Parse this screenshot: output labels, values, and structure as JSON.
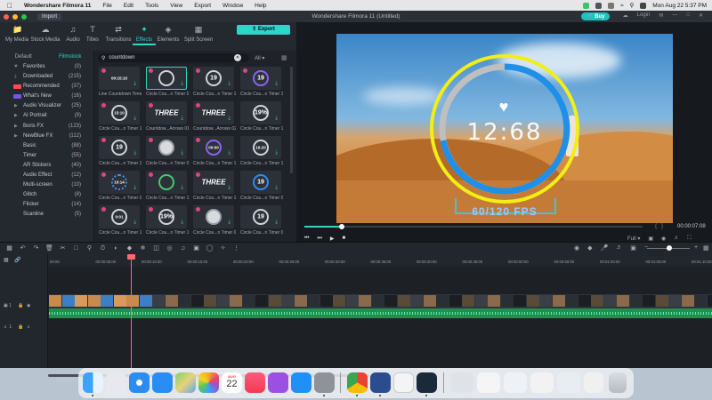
{
  "menubar": {
    "app_name": "Wondershare Filmora 11",
    "items": [
      "File",
      "Edit",
      "Tools",
      "View",
      "Export",
      "Window",
      "Help"
    ],
    "clock": "Mon Aug 22  5:37 PM"
  },
  "titlebar": {
    "import_label": "Import",
    "title": "Wondershare Filmora 11 (Untitled)",
    "buy_label": "Buy",
    "login_label": "Login",
    "export_label": "Export"
  },
  "tabs": [
    {
      "label": "My Media",
      "icon": "folder-icon"
    },
    {
      "label": "Stock Media",
      "icon": "cloud-icon"
    },
    {
      "label": "Audio",
      "icon": "music-icon"
    },
    {
      "label": "Titles",
      "icon": "title-icon"
    },
    {
      "label": "Transitions",
      "icon": "transition-icon"
    },
    {
      "label": "Effects",
      "icon": "effects-icon"
    },
    {
      "label": "Elements",
      "icon": "elements-icon"
    },
    {
      "label": "Split Screen",
      "icon": "split-screen-icon"
    }
  ],
  "sidebar": {
    "tabs": [
      "Default",
      "Filmstock"
    ],
    "active_tab": "Filmstock",
    "items": [
      {
        "label": "Favorites",
        "count": "(0)",
        "icon": "heart-icon"
      },
      {
        "label": "Downloaded",
        "count": "(215)",
        "icon": "download-icon"
      },
      {
        "label": "Recommended",
        "count": "(37)",
        "icon": "hot-badge"
      },
      {
        "label": "What's New",
        "count": "(16)",
        "icon": "new-badge"
      },
      {
        "label": "Audio Visualizer",
        "count": "(25)",
        "arrow": true
      },
      {
        "label": "AI Portrait",
        "count": "(9)",
        "arrow": true
      },
      {
        "label": "Boris FX",
        "count": "(123)",
        "arrow": true
      },
      {
        "label": "NewBlue FX",
        "count": "(112)",
        "arrow": true
      },
      {
        "label": "Basic",
        "count": "(88)"
      },
      {
        "label": "Timer",
        "count": "(55)"
      },
      {
        "label": "AR Stickers",
        "count": "(40)"
      },
      {
        "label": "Audio Effect",
        "count": "(12)"
      },
      {
        "label": "Multi-screen",
        "count": "(10)"
      },
      {
        "label": "Glitch",
        "count": "(8)"
      },
      {
        "label": "Flicker",
        "count": "(14)"
      },
      {
        "label": "Scanline",
        "count": "(5)"
      }
    ]
  },
  "search": {
    "value": "countdown",
    "filter": "All"
  },
  "effects": [
    {
      "label": "Line Countdown Timer",
      "kind": "text",
      "text": "00:15:10"
    },
    {
      "label": "Circle Cou...n Timer 04",
      "kind": "ring",
      "text": "",
      "sel": true
    },
    {
      "label": "Circle Cou...n Timer 16",
      "kind": "ring",
      "text": "19"
    },
    {
      "label": "Circle Cou...n Timer 17",
      "kind": "ring-purple",
      "text": "19"
    },
    {
      "label": "Circle Cou...n Timer 12",
      "kind": "ring",
      "text": "15:10"
    },
    {
      "label": "Countdow...Arrows 01",
      "kind": "bold",
      "text": "THREE"
    },
    {
      "label": "Countdow...Arrows 02",
      "kind": "bold",
      "text": "THREE"
    },
    {
      "label": "Circle Cou...n Timer 11",
      "kind": "ring",
      "text": "19%"
    },
    {
      "label": "Circle Cou...n Timer 18",
      "kind": "ring",
      "text": "19"
    },
    {
      "label": "Circle Cou...n Timer 09",
      "kind": "disc",
      "text": ""
    },
    {
      "label": "Circle Cou...n Timer 12",
      "kind": "ring-purple",
      "text": "00:00"
    },
    {
      "label": "Circle Cou...n Timer 15",
      "kind": "ring",
      "text": "19:20"
    },
    {
      "label": "Circle Cou...n Timer 01",
      "kind": "ring-dots",
      "text": "10:14"
    },
    {
      "label": "Circle Cou...n Timer 13",
      "kind": "ring-green",
      "text": ""
    },
    {
      "label": "Circle Cou...n Timer 19",
      "kind": "bold",
      "text": "THREE"
    },
    {
      "label": "Circle Cou...n Timer 02",
      "kind": "ring-blue",
      "text": "19"
    },
    {
      "label": "Circle Cou...n Timer 10",
      "kind": "ring",
      "text": "0:01"
    },
    {
      "label": "Circle Cou...n Timer 14",
      "kind": "ring",
      "text": "19%"
    },
    {
      "label": "Circle Cou...n Timer 05",
      "kind": "disc",
      "text": ""
    },
    {
      "label": "Circle Cou...n Timer 08",
      "kind": "ring",
      "text": "19"
    }
  ],
  "preview": {
    "timer_text": "12:68",
    "fps_text": "60/120 FPS",
    "timecode": "00:00:07:08",
    "quality": "Full",
    "progress": 0.11
  },
  "timeline": {
    "ruler": [
      "00:00",
      "00:00:05:00",
      "00:00:10:00",
      "00:00:15:00",
      "00:00:20:00",
      "00:00:25:00",
      "00:00:30:00",
      "00:00:35:00",
      "00:00:40:00",
      "00:00:45:00",
      "00:00:50:00",
      "00:00:55:00",
      "00:01:00:00",
      "00:01:05:00",
      "00:01:10:00"
    ],
    "video_track": "1",
    "audio_track": "1"
  },
  "dock": {
    "calendar_month": "AUG",
    "calendar_day": "22",
    "apps": [
      "finder-icon",
      "launchpad-icon",
      "safari-icon",
      "mail-icon",
      "maps-icon",
      "photos-icon",
      "calendar-icon",
      "music-icon",
      "podcasts-icon",
      "app-store-icon",
      "system-preferences-icon",
      "chrome-icon",
      "filmora-icon",
      "notes-icon",
      "filmora-launcher-icon"
    ]
  }
}
